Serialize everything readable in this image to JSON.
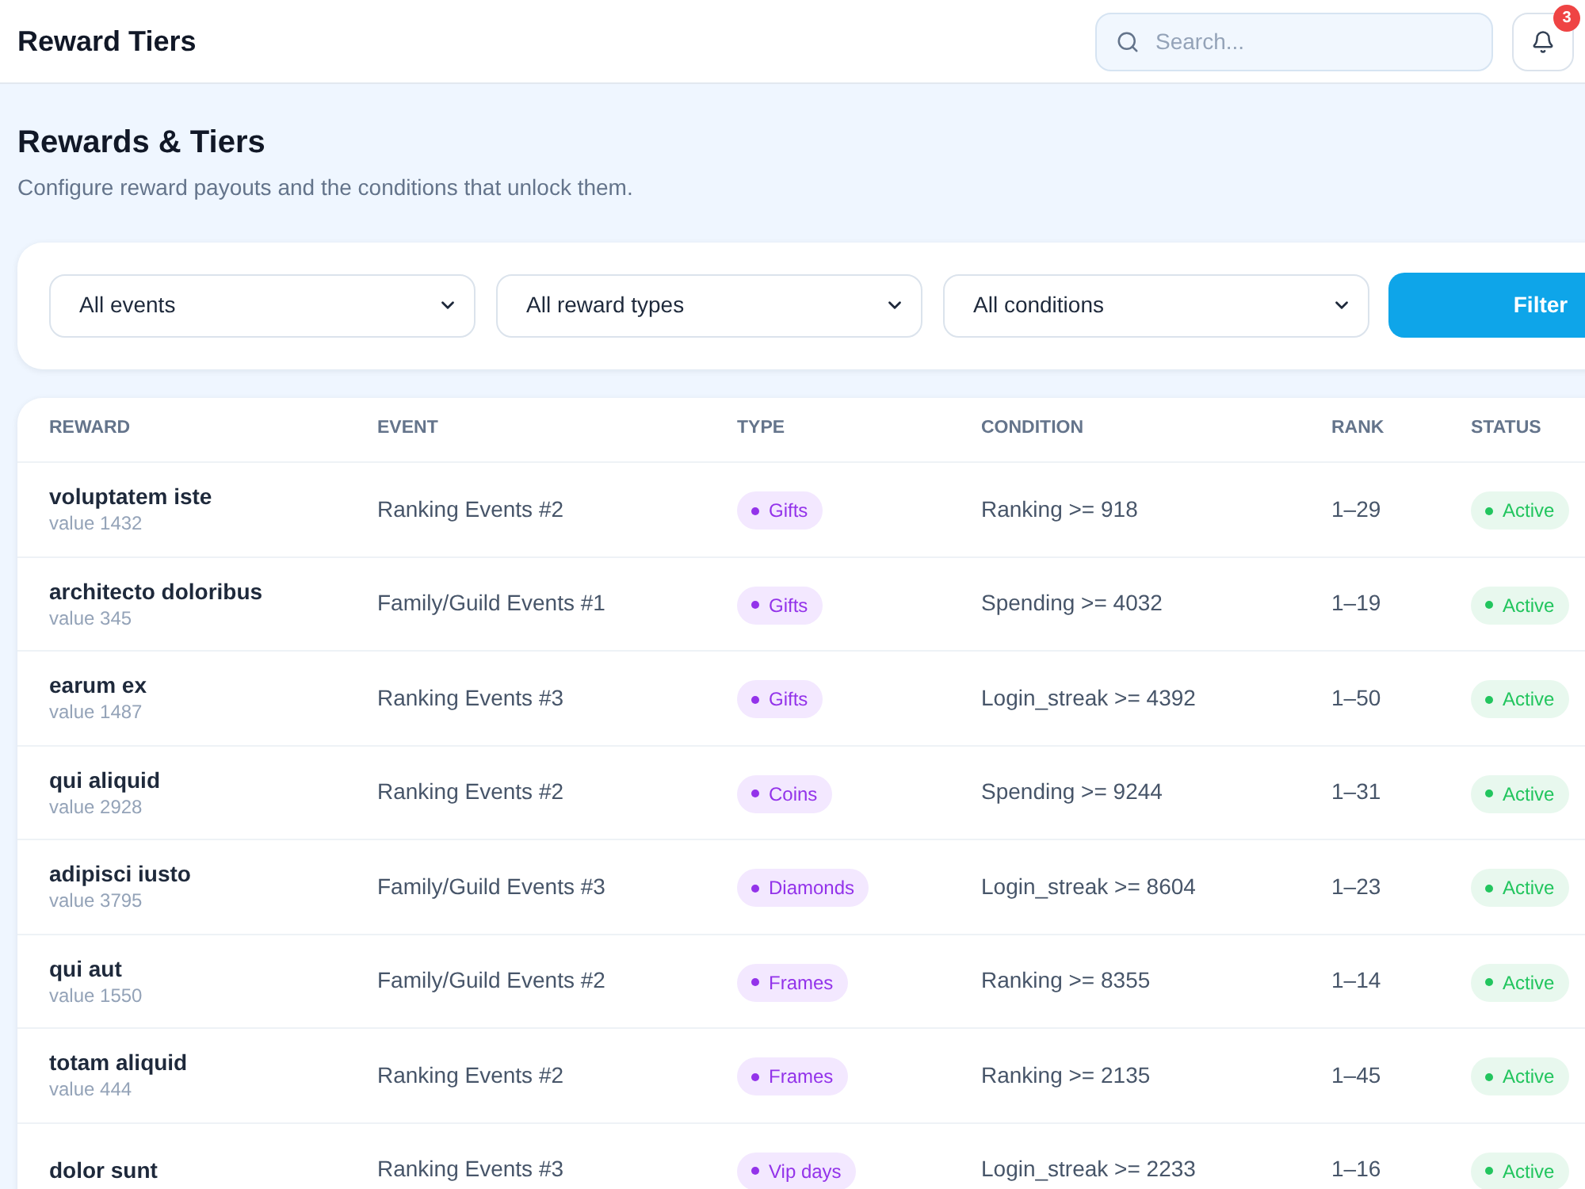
{
  "header": {
    "title": "Reward Tiers",
    "search": {
      "placeholder": "Search..."
    },
    "notifications": {
      "count": "3"
    }
  },
  "page": {
    "title": "Rewards & Tiers",
    "subtitle": "Configure reward payouts and the conditions that unlock them."
  },
  "filters": {
    "selects": [
      "All events",
      "All reward types",
      "All conditions"
    ],
    "button": "Filter"
  },
  "table": {
    "columns": [
      "REWARD",
      "EVENT",
      "TYPE",
      "CONDITION",
      "RANK",
      "STATUS"
    ],
    "rows": [
      {
        "reward": "voluptatem iste",
        "value": "value 1432",
        "event": "Ranking Events #2",
        "type": "Gifts",
        "condition": "Ranking >= 918",
        "rank": "1–29",
        "status": "Active"
      },
      {
        "reward": "architecto doloribus",
        "value": "value 345",
        "event": "Family/Guild Events #1",
        "type": "Gifts",
        "condition": "Spending >= 4032",
        "rank": "1–19",
        "status": "Active"
      },
      {
        "reward": "earum ex",
        "value": "value 1487",
        "event": "Ranking Events #3",
        "type": "Gifts",
        "condition": "Login_streak >= 4392",
        "rank": "1–50",
        "status": "Active"
      },
      {
        "reward": "qui aliquid",
        "value": "value 2928",
        "event": "Ranking Events #2",
        "type": "Coins",
        "condition": "Spending >= 9244",
        "rank": "1–31",
        "status": "Active"
      },
      {
        "reward": "adipisci iusto",
        "value": "value 3795",
        "event": "Family/Guild Events #3",
        "type": "Diamonds",
        "condition": "Login_streak >= 8604",
        "rank": "1–23",
        "status": "Active"
      },
      {
        "reward": "qui aut",
        "value": "value 1550",
        "event": "Family/Guild Events #2",
        "type": "Frames",
        "condition": "Ranking >= 8355",
        "rank": "1–14",
        "status": "Active"
      },
      {
        "reward": "totam aliquid",
        "value": "value 444",
        "event": "Ranking Events #2",
        "type": "Frames",
        "condition": "Ranking >= 2135",
        "rank": "1–45",
        "status": "Active"
      },
      {
        "reward": "dolor sunt",
        "event": "Ranking Events #3",
        "type": "Vip days",
        "condition": "Login_streak >= 2233",
        "rank": "1–16",
        "status": "Active"
      }
    ]
  }
}
